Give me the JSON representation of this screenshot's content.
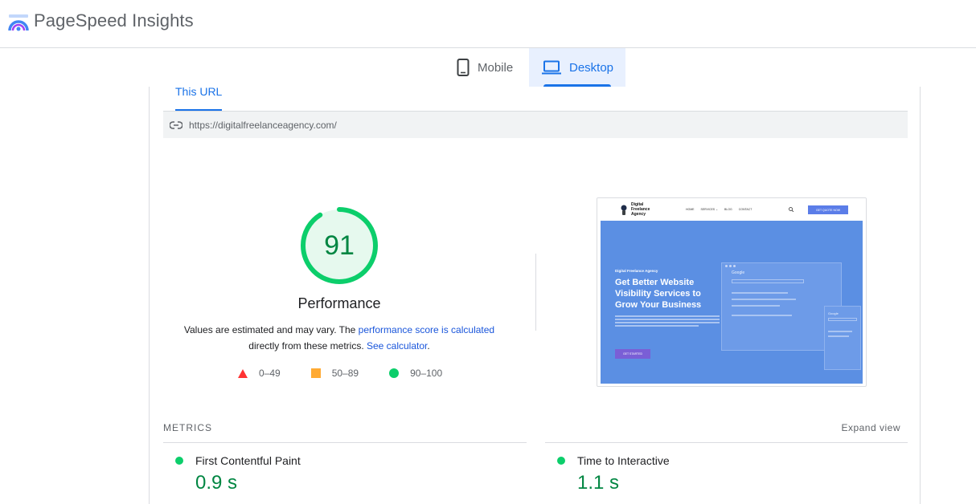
{
  "header": {
    "app_title": "PageSpeed Insights",
    "logo_icon": "pagespeed-logo-icon"
  },
  "device_tabs": [
    {
      "label": "Mobile",
      "icon": "phone-icon",
      "active": false
    },
    {
      "label": "Desktop",
      "icon": "laptop-icon",
      "active": true
    }
  ],
  "url_tab": {
    "label": "This URL"
  },
  "url_bar": {
    "icon": "link-icon",
    "url": "https://digitalfreelanceagency.com/"
  },
  "performance": {
    "score": "91",
    "score_value": 91,
    "label": "Performance",
    "desc_text_1": "Values are estimated and may vary. The ",
    "desc_link_1": "performance score is calculated",
    "desc_text_2": " directly from these metrics. ",
    "desc_link_2": "See calculator",
    "desc_text_3": "."
  },
  "legend": [
    {
      "shape": "triangle",
      "color": "#ff3333",
      "label": "0–49"
    },
    {
      "shape": "square",
      "color": "#ffaa33",
      "label": "50–89"
    },
    {
      "shape": "circle",
      "color": "#0cce6b",
      "label": "90–100"
    }
  ],
  "screenshot": {
    "brand_line_1": "Digital",
    "brand_line_2": "Freelance",
    "brand_line_3": "Agency",
    "nav_items": [
      "HOME",
      "SERVICES ⌄",
      "BLOG",
      "CONTACT"
    ],
    "cta_button": "GET QUOTE NOW",
    "hero_kicker": "Digital Freelance Agency",
    "hero_title": "Get Better Website Visibility Services to Grow Your Business",
    "hero_button": "GET STARTED",
    "mock_brand": "Google"
  },
  "metrics": {
    "title": "METRICS",
    "expand_label": "Expand view",
    "items": [
      {
        "name": "First Contentful Paint",
        "value": "0.9 s",
        "status_color": "#0cce6b"
      },
      {
        "name": "Time to Interactive",
        "value": "1.1 s",
        "status_color": "#0cce6b"
      }
    ]
  },
  "colors": {
    "accent": "#1a73e8",
    "pass": "#0cce6b",
    "pass_text": "#018642",
    "hero_blue": "#5b8fe3"
  }
}
